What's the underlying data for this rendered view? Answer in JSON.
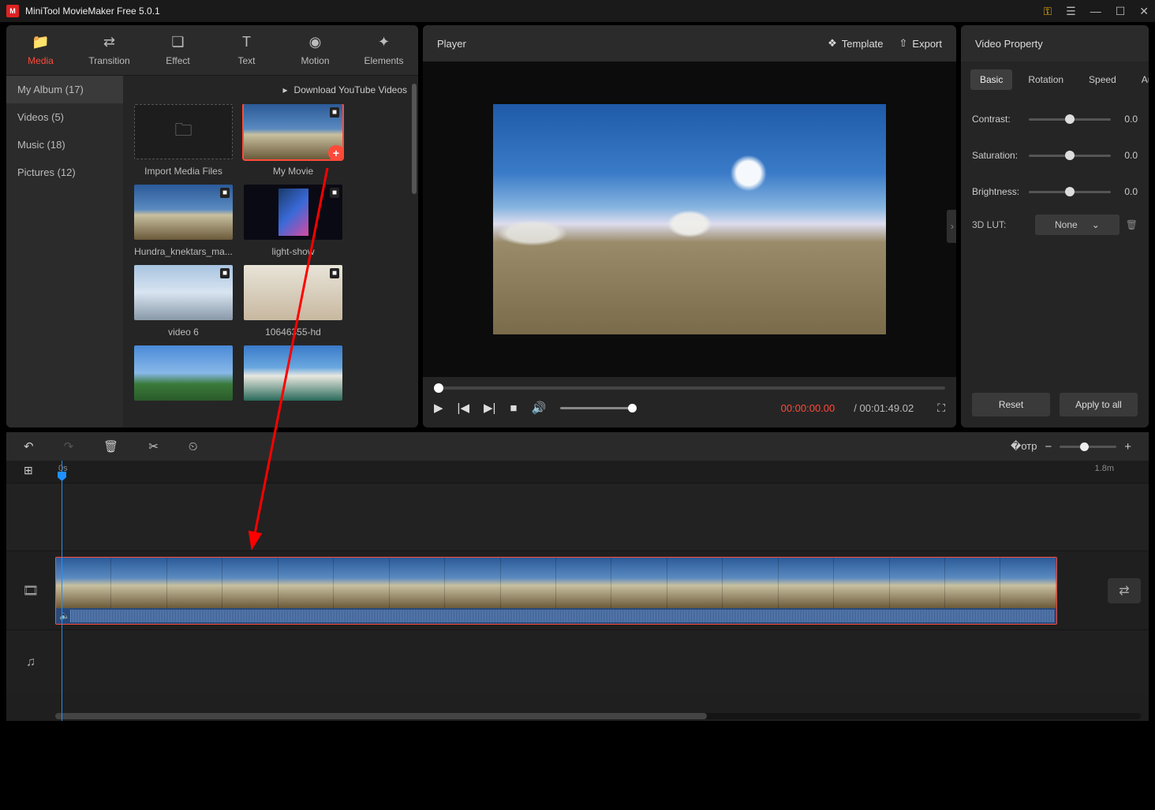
{
  "app": {
    "title": "MiniTool MovieMaker Free 5.0.1"
  },
  "tabs": {
    "media": "Media",
    "transition": "Transition",
    "effect": "Effect",
    "text": "Text",
    "motion": "Motion",
    "elements": "Elements"
  },
  "sidebar": {
    "items": [
      {
        "label": "My Album (17)"
      },
      {
        "label": "Videos (5)"
      },
      {
        "label": "Music (18)"
      },
      {
        "label": "Pictures (12)"
      }
    ]
  },
  "media": {
    "download_label": "Download YouTube Videos",
    "items": [
      {
        "label": "Import Media Files",
        "kind": "import"
      },
      {
        "label": "My Movie",
        "kind": "video",
        "selected": true
      },
      {
        "label": "Hundra_knektars_ma...",
        "kind": "video"
      },
      {
        "label": "light-show",
        "kind": "video"
      },
      {
        "label": "video 6",
        "kind": "video"
      },
      {
        "label": "10646355-hd",
        "kind": "video"
      },
      {
        "label": "",
        "kind": "image"
      },
      {
        "label": "",
        "kind": "image"
      }
    ]
  },
  "player": {
    "title": "Player",
    "template_label": "Template",
    "export_label": "Export",
    "current_time": "00:00:00.00",
    "total_time": "/ 00:01:49.02"
  },
  "properties": {
    "title": "Video Property",
    "tabs": {
      "basic": "Basic",
      "rotation": "Rotation",
      "speed": "Speed",
      "audio": "Audio"
    },
    "contrast": {
      "label": "Contrast:",
      "value": "0.0"
    },
    "saturation": {
      "label": "Saturation:",
      "value": "0.0"
    },
    "brightness": {
      "label": "Brightness:",
      "value": "0.0"
    },
    "lut": {
      "label": "3D LUT:",
      "value": "None"
    },
    "reset": "Reset",
    "apply": "Apply to all"
  },
  "timeline": {
    "start_label": "0s",
    "end_label": "1.8m"
  }
}
